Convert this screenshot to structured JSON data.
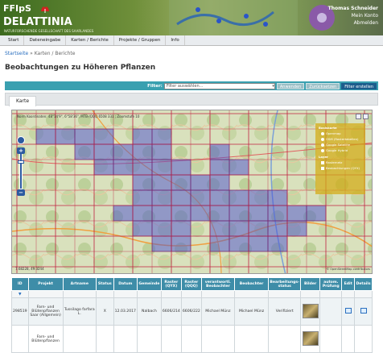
{
  "header": {
    "logo_top": "FFIpS",
    "logo_main": "DELATTINIA",
    "logo_sub": "NATURFORSCHENDE GESELLSCHAFT DES SAARLANDES",
    "user_name": "Thomas Schneider",
    "user_links": [
      "Mein Konto",
      "Abmelden"
    ]
  },
  "nav": [
    "Start",
    "Dateneingabe",
    "Karten / Berichte",
    "Projekte / Gruppen",
    "Info"
  ],
  "breadcrumb": {
    "home": "Startseite",
    "sep": "»",
    "current": "Karten / Berichte"
  },
  "page_title": "Beobachtungen zu Höheren Pflanzen",
  "filter": {
    "label": "Filter:",
    "placeholder": "Filter auswählen...",
    "apply": "Anwenden",
    "reset": "Zurücksetzen",
    "create": "Filter erstellen"
  },
  "tab": "Karte",
  "map": {
    "coords": "Norm Koordinaten: 48°14'9\", 6°58'36\", MTB-/QQQ 6508 331 ; Zoomstufe 10",
    "bottom_coords": "7.68228, 49.3244",
    "attribution": "© OpenStreetMap contributors",
    "legend": {
      "base_title": "Basiskarte",
      "base": [
        "Openmap",
        "OSM (Rastertabellen)",
        "Google Satellite",
        "Google Hybrid"
      ],
      "layers_title": "Layer",
      "layers": [
        "Rasternetz",
        "Beobachtungen (QYX)"
      ]
    }
  },
  "table": {
    "headers": [
      "ID",
      "Projekt",
      "Artname",
      "Status",
      "Datum",
      "Gemeinde",
      "Raster (QYX)",
      "Raster (QQQ)",
      "verantwortl. Beobachter",
      "Beobachter",
      "Bearbeitungs-status",
      "Bilder",
      "autom. Prüfung",
      "Edit",
      "Details"
    ],
    "rows": [
      {
        "id": "298519",
        "projekt": "Farn- und Blütenpflanzen Saar (Allgemein)",
        "artname": "Tussilago farfara L.",
        "status": "X",
        "datum": "12.03.2017",
        "gemeinde": "Nalbach",
        "qyx": "6606/214",
        "qqq": "6606/222",
        "verantw": "Michael Münz",
        "beobachter": "Michael Münz",
        "bearb": "Verifiziert"
      },
      {
        "id": "",
        "projekt": "Farn- und Blütenpflanzen",
        "artname": "",
        "status": "",
        "datum": "",
        "gemeinde": "",
        "qyx": "",
        "qqq": "",
        "verantw": "",
        "beobachter": "",
        "bearb": ""
      }
    ]
  },
  "colors": {
    "filter_bar": "#3aa0b0",
    "table_header": "#3e8da8",
    "grid_fill": "#4a50d0",
    "legend": "#d2aa14"
  }
}
